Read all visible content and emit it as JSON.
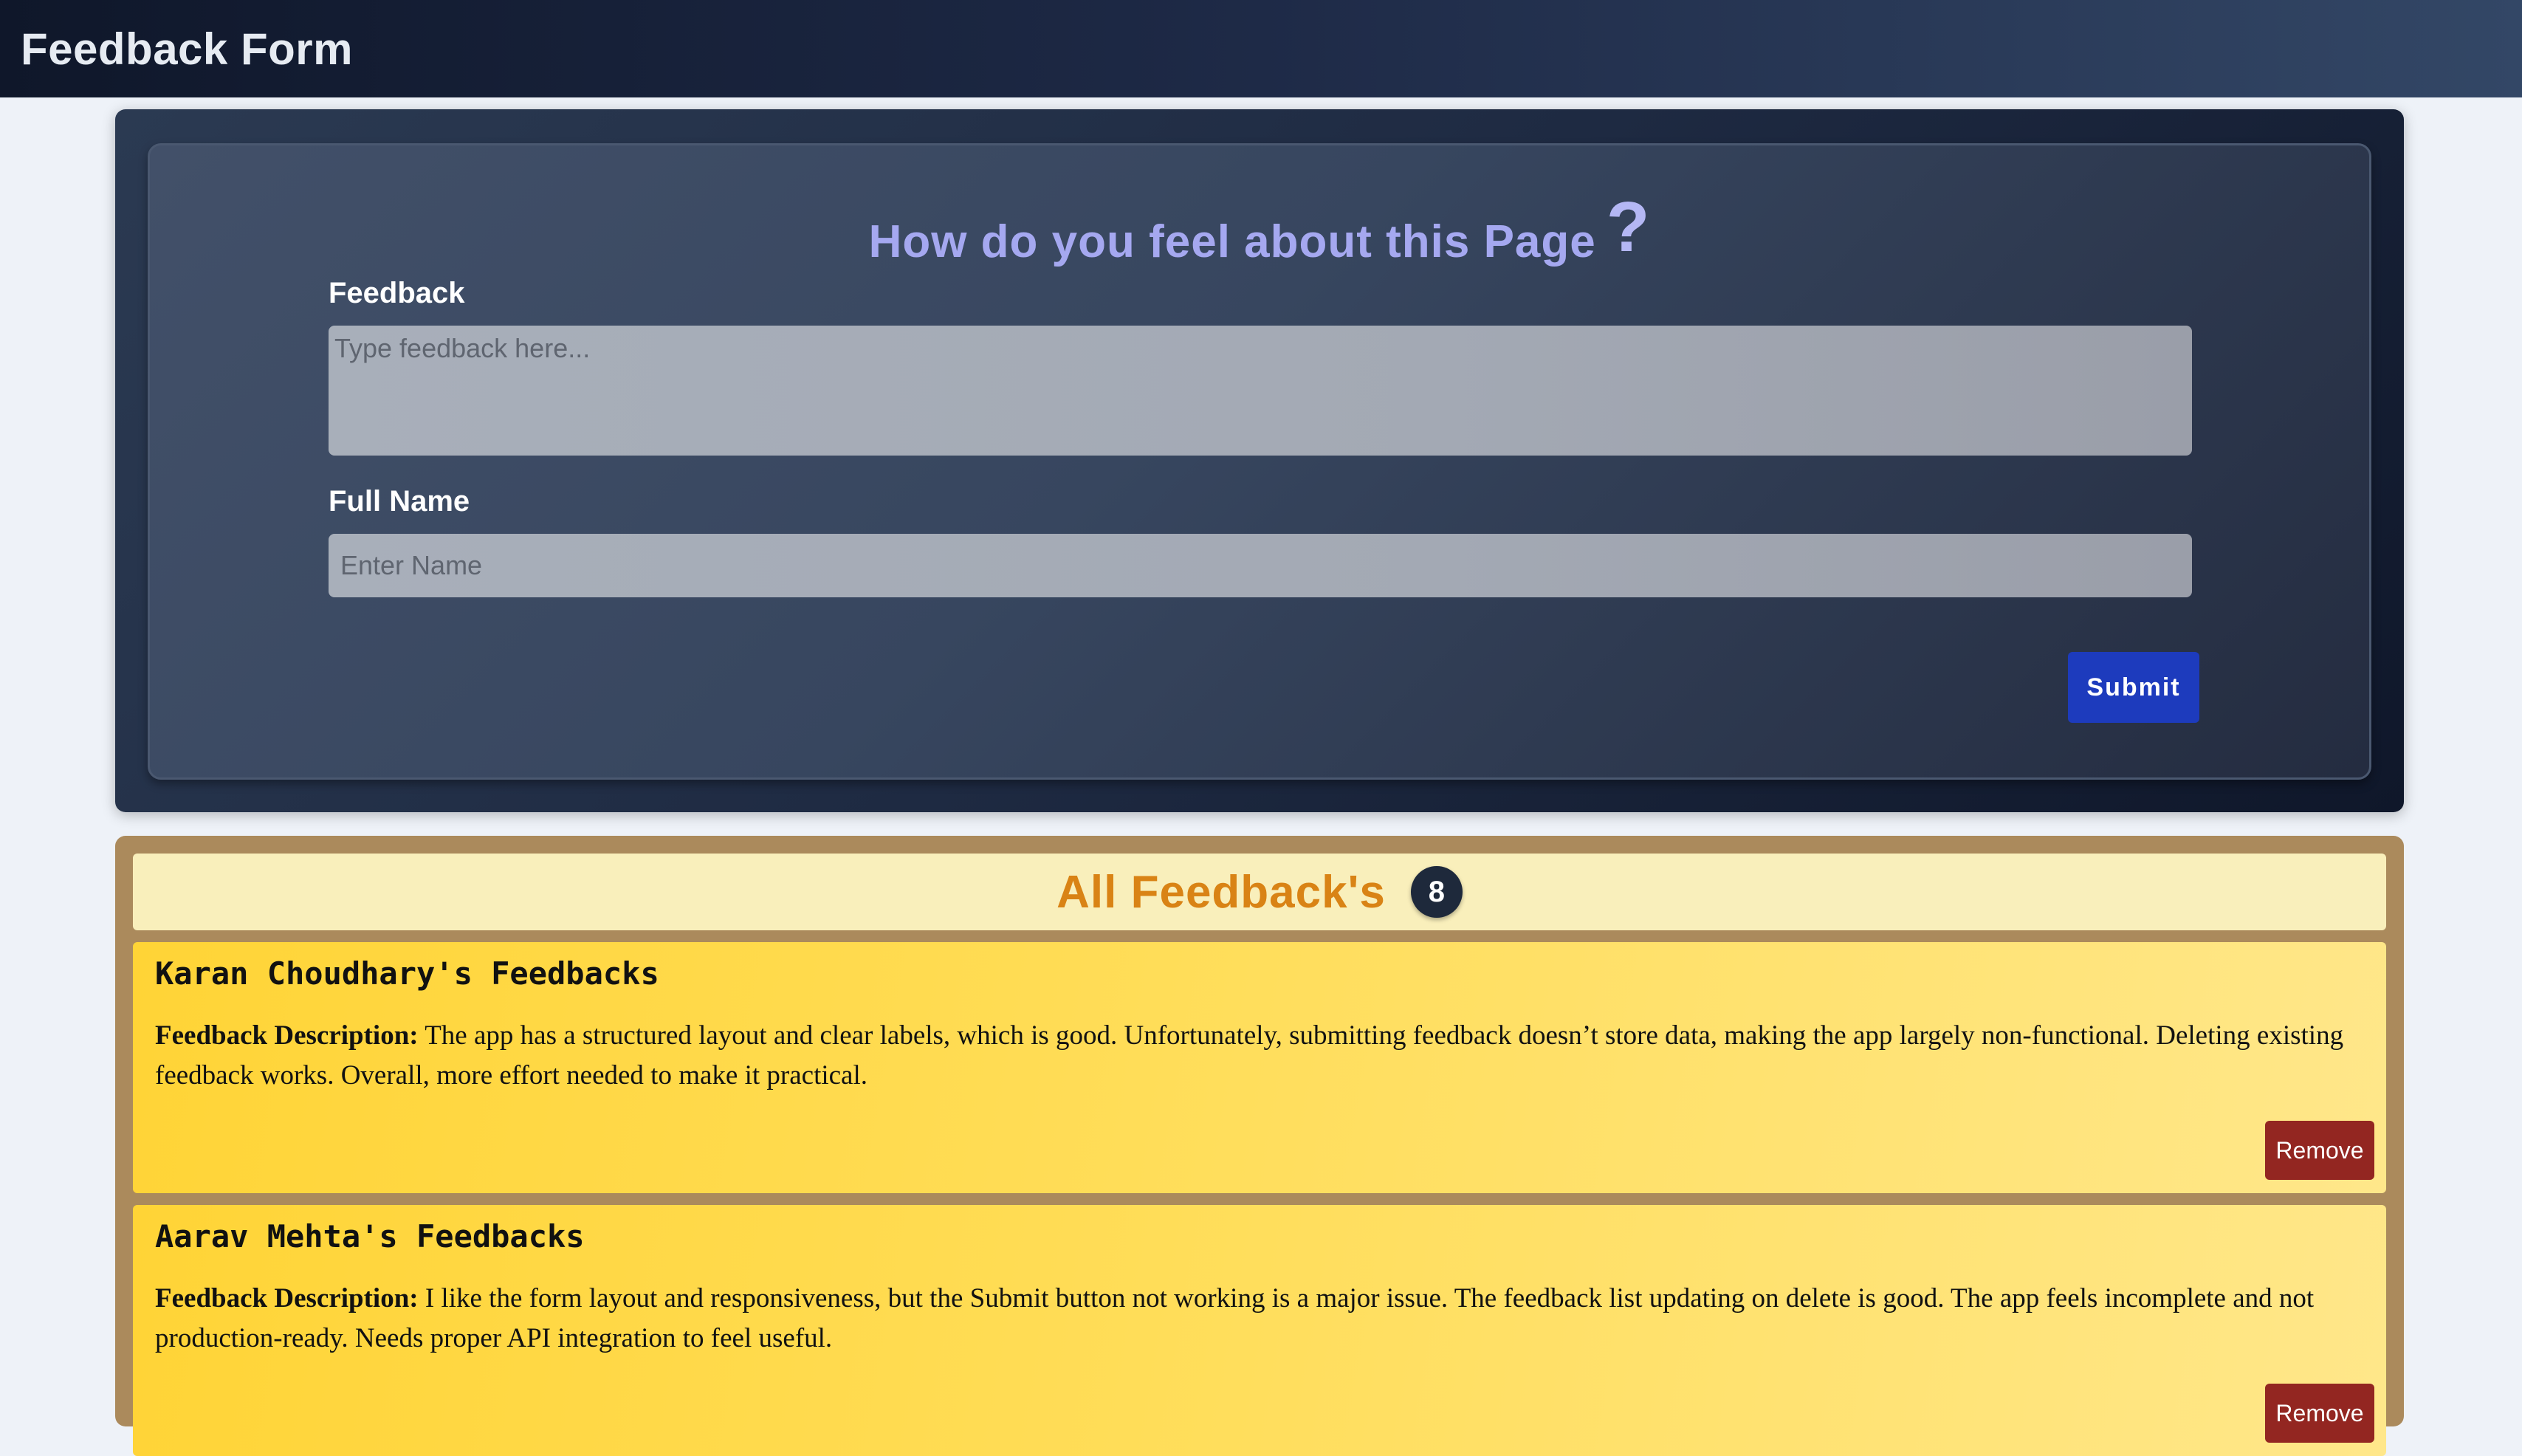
{
  "header": {
    "title": "Feedback Form"
  },
  "form": {
    "heading": "How do you feel about this Page",
    "heading_icon": "?",
    "feedback_label": "Feedback",
    "feedback_placeholder": "Type feedback here...",
    "feedback_value": "",
    "name_label": "Full Name",
    "name_placeholder": "Enter Name",
    "name_value": "",
    "submit_label": "Submit"
  },
  "feedback_list": {
    "title": "All Feedback's",
    "count": "8",
    "description_label": "Feedback Description:",
    "remove_label": "Remove",
    "items": [
      {
        "title": "Karan Choudhary's Feedbacks",
        "description": "The app has a structured layout and clear labels, which is good. Unfortunately, submitting feedback doesn’t store data, making the app largely non-functional. Deleting existing feedback works. Overall, more effort needed to make it practical."
      },
      {
        "title": "Aarav Mehta's Feedbacks",
        "description": "I like the form layout and responsiveness, but the Submit button not working is a major issue. The feedback list updating on delete is good. The app feels incomplete and not production-ready. Needs proper API integration to feel useful."
      }
    ]
  },
  "colors": {
    "header_bg": "#0f172a",
    "heading_accent": "#a5a8f0",
    "submit_bg": "#1d3bbd",
    "list_title": "#d98315",
    "card_bg": "#ffd436",
    "remove_bg": "#932621",
    "badge_bg": "#1e293b"
  }
}
